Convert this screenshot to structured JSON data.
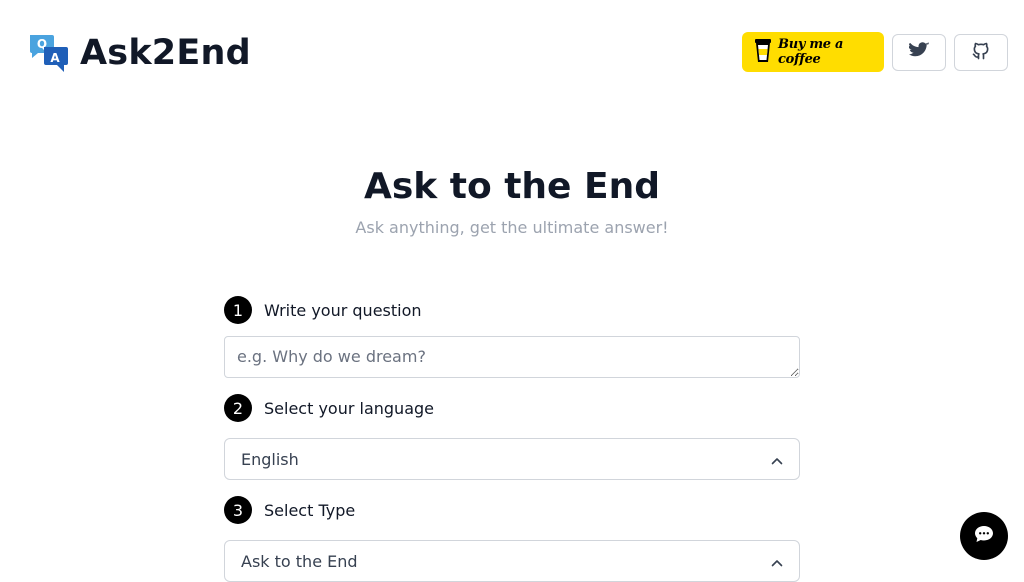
{
  "brand": {
    "name": "Ask2End",
    "logo_icon": "qa-speech-bubbles-icon"
  },
  "header": {
    "coffee_label": "Buy me a coffee",
    "coffee_color": "#FFDD00",
    "twitter_icon": "twitter-icon",
    "github_icon": "github-icon"
  },
  "hero": {
    "title": "Ask to the End",
    "subtitle": "Ask anything, get the ultimate answer!"
  },
  "steps": [
    {
      "number": "1",
      "label": "Write your question",
      "placeholder": "e.g. Why do we dream?"
    },
    {
      "number": "2",
      "label": "Select your language",
      "value": "English"
    },
    {
      "number": "3",
      "label": "Select Type",
      "value": "Ask to the End"
    }
  ],
  "chat": {
    "icon": "chat-bubble-icon"
  }
}
